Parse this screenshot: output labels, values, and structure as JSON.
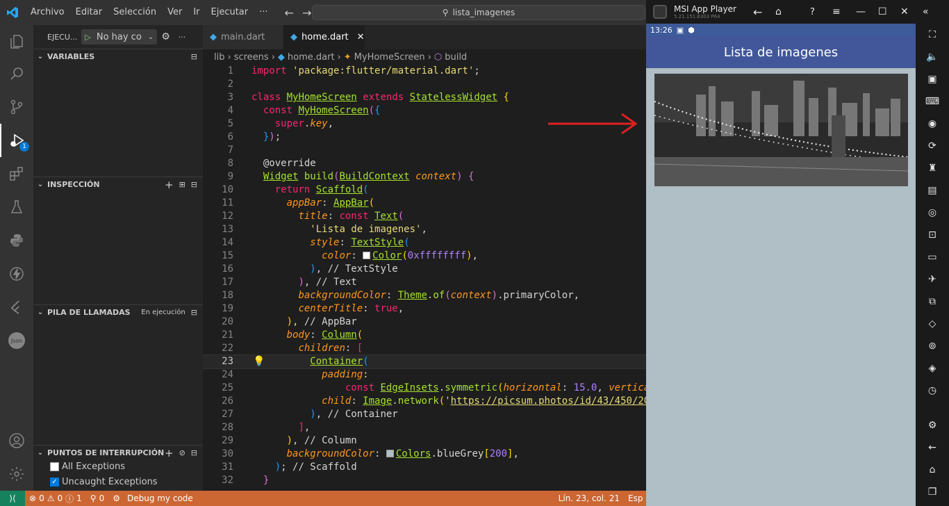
{
  "titlebar": {
    "menu": [
      "Archivo",
      "Editar",
      "Selección",
      "Ver",
      "Ir",
      "Ejecutar",
      "···"
    ],
    "search": "lista_imagenes"
  },
  "sidebar": {
    "run_label": "EJECU...",
    "config": "No hay coı",
    "sections": {
      "variables": "VARIABLES",
      "watch": "INSPECCIÓN",
      "callstack": "PILA DE LLAMADAS",
      "callstack_status": "En ejecución",
      "breakpoints": "PUNTOS DE INTERRUPCIÓN"
    },
    "breakpoints": [
      {
        "label": "All Exceptions",
        "checked": false
      },
      {
        "label": "Uncaught Exceptions",
        "checked": true
      }
    ],
    "debug_badge": "1"
  },
  "editor": {
    "tabs": [
      {
        "label": "main.dart",
        "active": false
      },
      {
        "label": "home.dart",
        "active": true
      }
    ],
    "breadcrumb": [
      "lib",
      "screens",
      "home.dart",
      "MyHomeScreen",
      "build"
    ],
    "current_line": 23,
    "lines": [
      {
        "n": "1"
      },
      {
        "n": "2"
      },
      {
        "n": "3"
      },
      {
        "n": "4"
      },
      {
        "n": "5"
      },
      {
        "n": "6"
      },
      {
        "n": "7"
      },
      {
        "n": "8"
      },
      {
        "n": "9"
      },
      {
        "n": "10"
      },
      {
        "n": "11"
      },
      {
        "n": "12"
      },
      {
        "n": "13"
      },
      {
        "n": "14"
      },
      {
        "n": "15"
      },
      {
        "n": "16"
      },
      {
        "n": "17"
      },
      {
        "n": "18"
      },
      {
        "n": "19"
      },
      {
        "n": "20"
      },
      {
        "n": "21"
      },
      {
        "n": "22"
      },
      {
        "n": "23"
      },
      {
        "n": "24"
      },
      {
        "n": "25"
      },
      {
        "n": "26"
      },
      {
        "n": "27"
      },
      {
        "n": "28"
      },
      {
        "n": "29"
      },
      {
        "n": "30"
      },
      {
        "n": "31"
      },
      {
        "n": "32"
      }
    ]
  },
  "statusbar": {
    "errors": "0",
    "warnings": "0",
    "info": "1",
    "ports": "0",
    "debug": "Debug my code",
    "position": "Lín. 23, col. 21",
    "lang": "Esp"
  },
  "emulator": {
    "title": "MSI App Player",
    "version": "5.21.151.6303  P64",
    "time": "13:26",
    "app_title": "Lista de imagenes"
  }
}
